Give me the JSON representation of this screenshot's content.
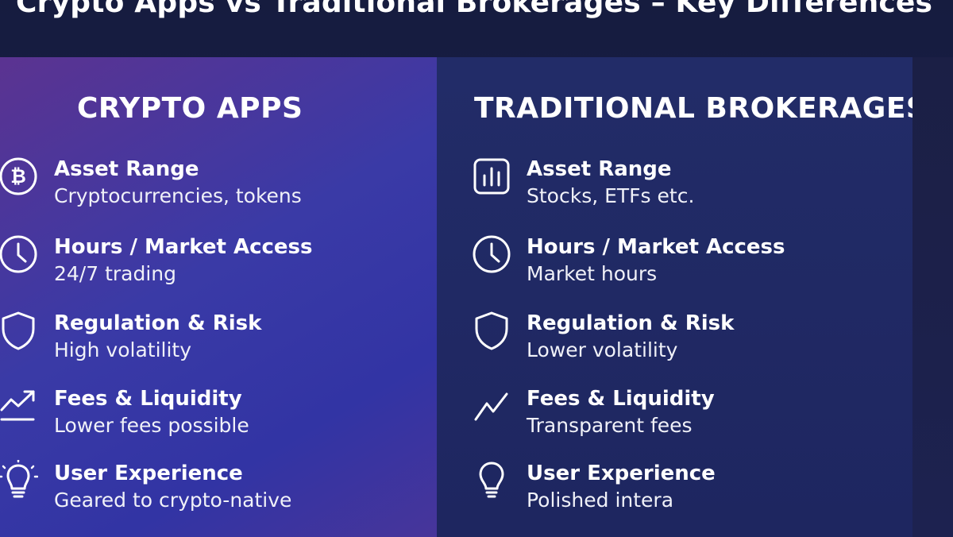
{
  "title": "Crypto Apps vs Traditional Brokerages – Key Differences",
  "columns": [
    {
      "heading": "CRYPTO APPS",
      "rows": [
        {
          "icon": "bitcoin-icon",
          "label": "Asset Range",
          "value": "Cryptocurrencies, tokens"
        },
        {
          "icon": "clock-icon",
          "label": "Hours / Market Access",
          "value": "24/7 trading"
        },
        {
          "icon": "shield-icon",
          "label": "Regulation & Risk",
          "value": "High volatility"
        },
        {
          "icon": "trend-up-icon",
          "label": "Fees & Liquidity",
          "value": "Lower fees possible"
        },
        {
          "icon": "lightbulb-icon",
          "label": "User Experience",
          "value": "Geared to crypto-native"
        }
      ]
    },
    {
      "heading": "TRADITIONAL BROKERAGES",
      "rows": [
        {
          "icon": "bar-chart-icon",
          "label": "Asset Range",
          "value": "Stocks, ETFs etc."
        },
        {
          "icon": "clock-icon",
          "label": "Hours / Market Access",
          "value": "Market hours"
        },
        {
          "icon": "shield-icon",
          "label": "Regulation & Risk",
          "value": "Lower volatility"
        },
        {
          "icon": "trend-line-icon",
          "label": "Fees & Liquidity",
          "value": "Transparent fees"
        },
        {
          "icon": "lightbulb-icon",
          "label": "User Experience",
          "value": "Polished intera"
        }
      ]
    }
  ],
  "colors": {
    "background": "#171d42",
    "left_panel_start": "#5b3391",
    "left_panel_end": "#3234a4",
    "right_panel": "#222c68",
    "text": "#ffffff"
  }
}
